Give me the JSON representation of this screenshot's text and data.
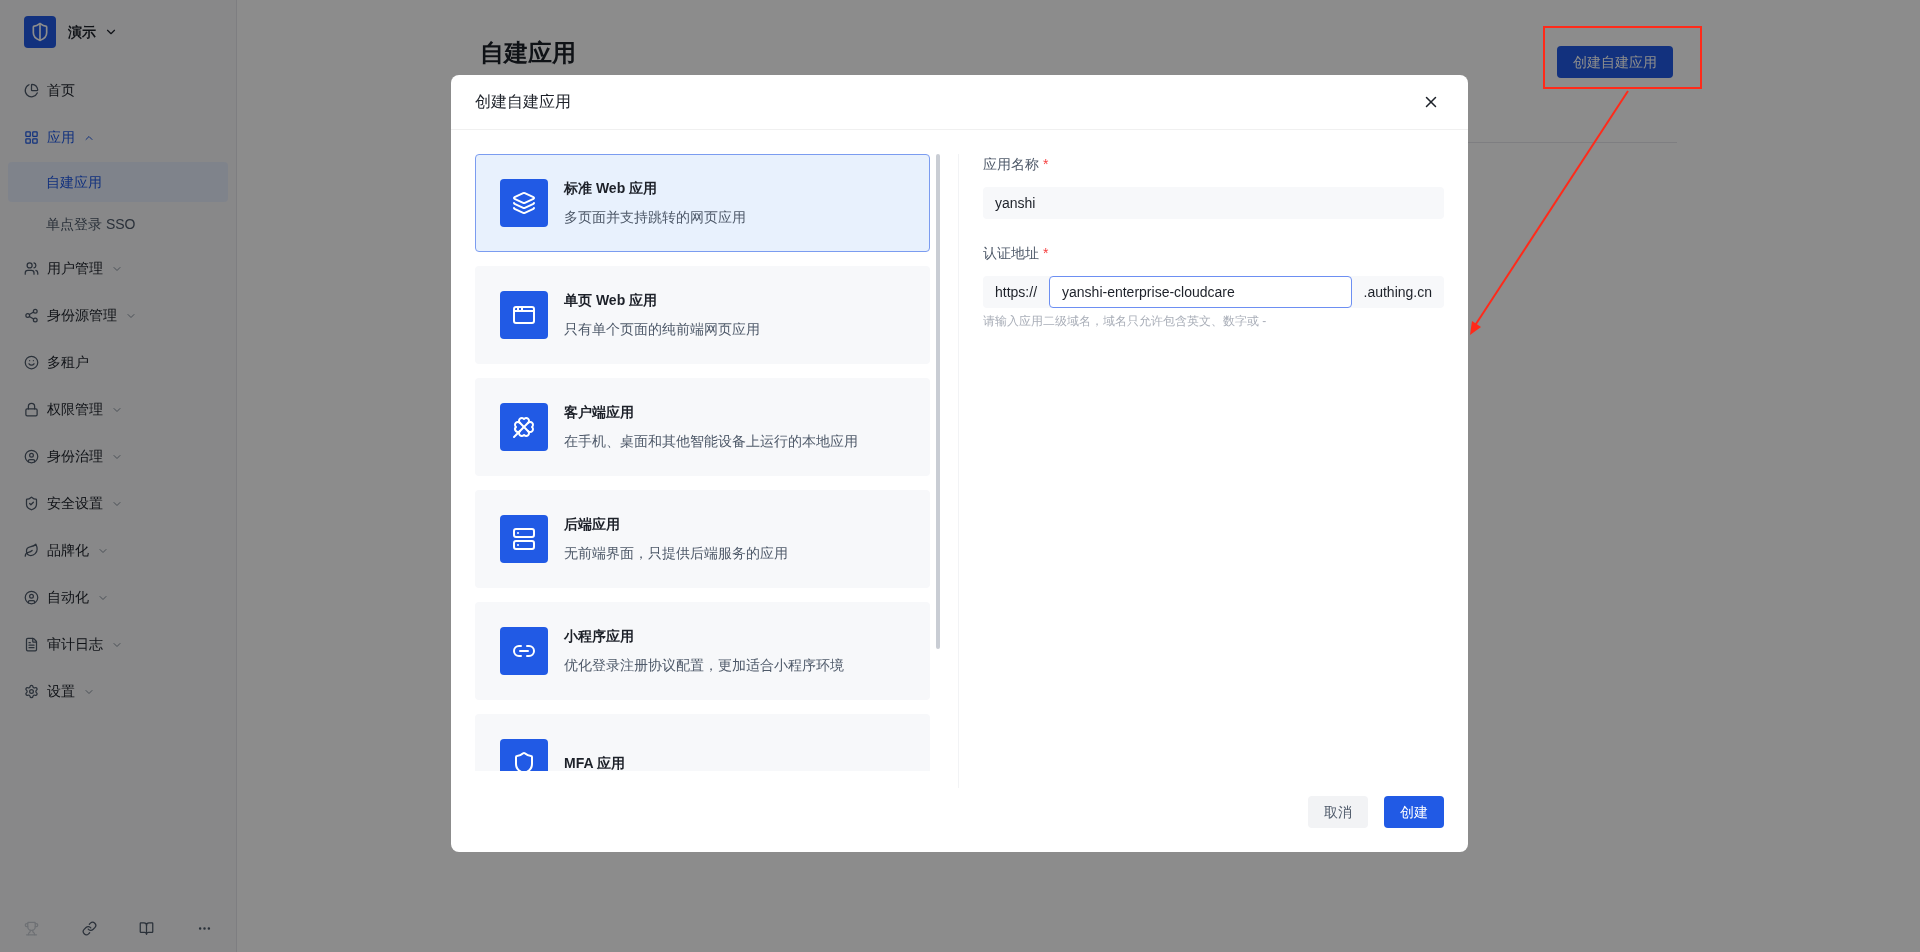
{
  "sidebar": {
    "workspace": "演示",
    "items": [
      {
        "label": "首页",
        "selected": false
      },
      {
        "label": "应用",
        "selected": true,
        "expanded": true,
        "children": [
          {
            "label": "自建应用",
            "selected": true
          },
          {
            "label": "单点登录 SSO",
            "selected": false
          }
        ]
      },
      {
        "label": "用户管理",
        "selected": false,
        "expanded": false
      },
      {
        "label": "身份源管理",
        "selected": false,
        "expanded": false
      },
      {
        "label": "多租户",
        "selected": false
      },
      {
        "label": "权限管理",
        "selected": false,
        "expanded": false
      },
      {
        "label": "身份治理",
        "selected": false,
        "expanded": false
      },
      {
        "label": "安全设置",
        "selected": false,
        "expanded": false
      },
      {
        "label": "品牌化",
        "selected": false,
        "expanded": false
      },
      {
        "label": "自动化",
        "selected": false,
        "expanded": false
      },
      {
        "label": "审计日志",
        "selected": false,
        "expanded": false
      },
      {
        "label": "设置",
        "selected": false,
        "expanded": false
      }
    ]
  },
  "page": {
    "title": "自建应用",
    "create_button": "创建自建应用"
  },
  "modal": {
    "title": "创建自建应用",
    "app_types": [
      {
        "title": "标准 Web 应用",
        "description": "多页面并支持跳转的网页应用",
        "selected": true
      },
      {
        "title": "单页 Web 应用",
        "description": "只有单个页面的纯前端网页应用",
        "selected": false
      },
      {
        "title": "客户端应用",
        "description": "在手机、桌面和其他智能设备上运行的本地应用",
        "selected": false
      },
      {
        "title": "后端应用",
        "description": "无前端界面，只提供后端服务的应用",
        "selected": false
      },
      {
        "title": "小程序应用",
        "description": "优化登录注册协议配置，更加适合小程序环境",
        "selected": false
      },
      {
        "title": "MFA 应用",
        "selected": false
      }
    ],
    "name_field": {
      "label": "应用名称",
      "required_mark": "*",
      "value": "yanshi"
    },
    "address_field": {
      "label": "认证地址",
      "required_mark": "*",
      "prefix": "https://",
      "value": "yanshi-enterprise-cloudcare",
      "suffix": ".authing.cn",
      "hint": "请输入应用二级域名，域名只允许包含英文、数字或 -"
    },
    "cancel_button": "取消",
    "create_button": "创建"
  }
}
